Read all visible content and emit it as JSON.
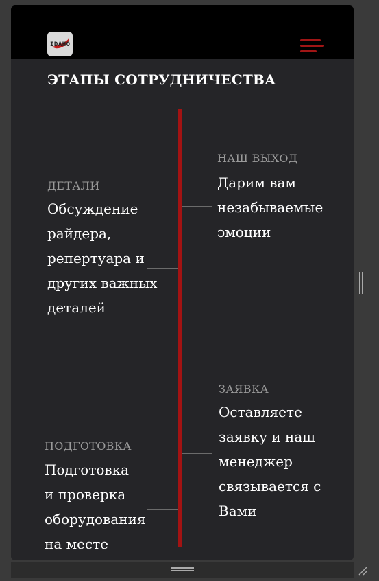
{
  "header": {
    "logo_text": "IDAHO",
    "title": "ЭТАПЫ СОТРУДНИЧЕСТВА"
  },
  "colors": {
    "accent": "#a31313",
    "background": "#252528",
    "topbar": "#000000"
  },
  "steps": [
    {
      "label": "НАШ ВЫХОД",
      "lines": [
        "Дарим вам",
        "незабываемые",
        "эмоции"
      ]
    },
    {
      "label": "ДЕТАЛИ",
      "lines": [
        "Обсуждение",
        "райдера,",
        "репертуара и",
        "других важных",
        "деталей"
      ]
    },
    {
      "label": "ЗАЯВКА",
      "lines": [
        "Оставляете",
        "заявку и наш",
        "менеджер",
        "связывается с",
        "Вами"
      ]
    },
    {
      "label": "ПОДГОТОВКА",
      "lines": [
        "Подготовка",
        "и проверка",
        "оборудования",
        "на месте"
      ]
    }
  ],
  "icons": {
    "menu": "hamburger-icon",
    "logo": "logo-icon"
  }
}
